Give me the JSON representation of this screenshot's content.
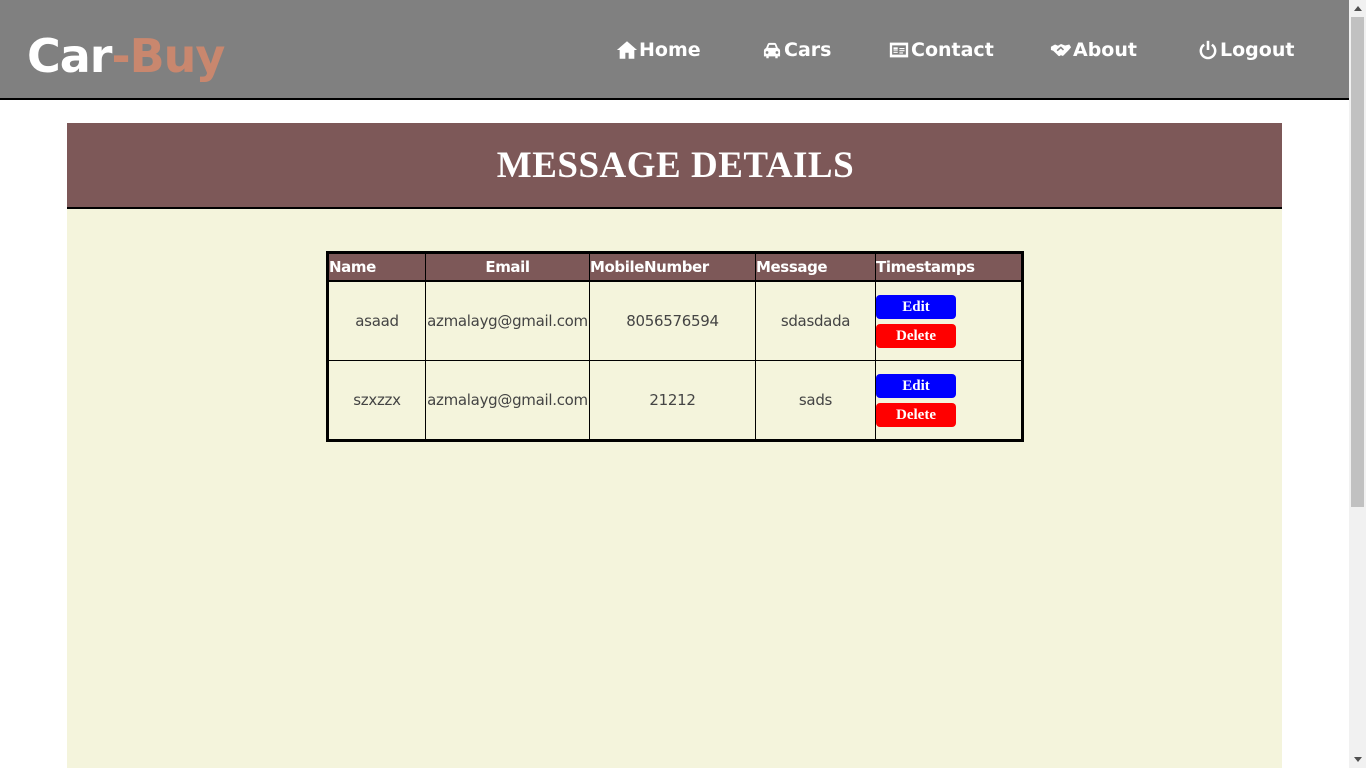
{
  "navbar": {
    "logo_main": "Car",
    "logo_accent": "-Buy",
    "items": [
      {
        "label": "Home",
        "icon": "home-icon"
      },
      {
        "label": "Cars",
        "icon": "car-icon"
      },
      {
        "label": "Contact",
        "icon": "contact-card-icon"
      },
      {
        "label": "About",
        "icon": "handshake-icon"
      },
      {
        "label": "Logout",
        "icon": "power-icon"
      }
    ]
  },
  "page": {
    "title": "MESSAGE DETAILS"
  },
  "table": {
    "headers": [
      "Name",
      "Email",
      "MobileNumber",
      "Message",
      "Timestamps"
    ],
    "rows": [
      {
        "name": "asaad",
        "email": "azmalayg@gmail.com",
        "mobile": "8056576594",
        "message": "sdasdada"
      },
      {
        "name": "szxzzx",
        "email": "azmalayg@gmail.com",
        "mobile": "21212",
        "message": "sads"
      }
    ],
    "edit_label": "Edit",
    "delete_label": "Delete"
  },
  "colors": {
    "navbar_bg": "#808080",
    "logo_accent": "#c9876e",
    "header_bg": "#7d5858",
    "panel_bg": "#f4f4dc",
    "edit_button": "#0000ff",
    "delete_button": "#ff0000"
  }
}
